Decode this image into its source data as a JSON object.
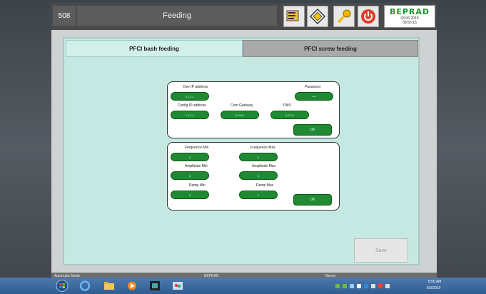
{
  "header": {
    "screen_number": "508",
    "title": "Feeding",
    "buttons": [
      "notes-icon",
      "navigation-icon",
      "key-icon",
      "power-icon"
    ],
    "logo": {
      "name": "BEPRAD",
      "date": "03.06.2019",
      "time": "08:55:15"
    }
  },
  "tabs": [
    {
      "label": "PFCI bash feeding"
    },
    {
      "label": "PFCI screw feeding"
    }
  ],
  "network": {
    "dev_ip_label": "Dev IP address",
    "dev_ip_value": "1.1.1.1",
    "password_label": "Password",
    "password_value": "****",
    "config_ip_label": "Config IP address",
    "config_ip_value": "1.1.1.1",
    "gateway_label": "Com Gateway",
    "gateway_value": "0.0.0.0",
    "dns_label": "DNS",
    "dns_value": "0.0.0.0",
    "ok_label": "OK"
  },
  "params": {
    "freq_min_label": "Frequence Min",
    "freq_min_value": "0",
    "freq_max_label": "Frequence Max",
    "freq_max_value": "0",
    "amp_min_label": "Amplitude Min",
    "amp_min_value": "0",
    "amp_max_label": "Amplitude Max",
    "amp_max_value": "0",
    "ramp_min_label": "Ramp Min",
    "ramp_min_value": "0",
    "ramp_max_label": "Ramp Max",
    "ramp_max_value": "0",
    "ok_label": "OK"
  },
  "save_label": "Save",
  "status": {
    "mode": "Automatic Mode",
    "company": "BEPRAD",
    "user": "Neves"
  },
  "taskbar": {
    "time": "8:55 AM",
    "date": "6/3/2019"
  },
  "colors": {
    "accent_green": "#1f8a32",
    "panel": "#c5e9e2",
    "logo_green": "#1a9a2a"
  }
}
